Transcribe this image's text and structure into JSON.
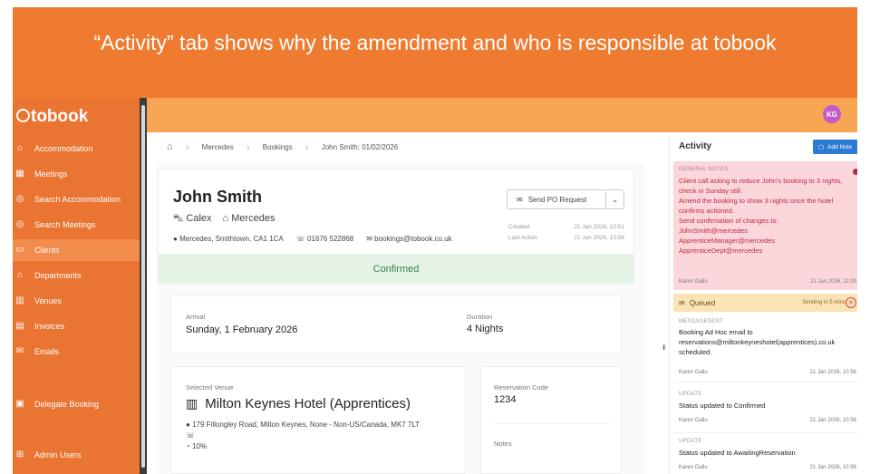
{
  "banner": {
    "text": "“Activity” tab shows why the amendment and who is responsible at tobook"
  },
  "sidebar": {
    "logo_o": "O",
    "logo_text": "tobook",
    "items": [
      {
        "label": "Accommodation",
        "icon": "house-icon"
      },
      {
        "label": "Meetings",
        "icon": "meetings-icon"
      },
      {
        "label": "Search Accommodation",
        "icon": "compass-icon"
      },
      {
        "label": "Search Meetings",
        "icon": "compass-icon"
      },
      {
        "label": "Clients",
        "icon": "clients-icon"
      },
      {
        "label": "Departments",
        "icon": "departments-icon"
      },
      {
        "label": "Venues",
        "icon": "building-icon"
      },
      {
        "label": "Invoices",
        "icon": "invoice-icon"
      },
      {
        "label": "Emails",
        "icon": "mail-icon"
      },
      {
        "label": "Delegate Booking",
        "icon": "calendar-icon"
      },
      {
        "label": "Admin Users",
        "icon": "admin-icon"
      }
    ],
    "active_item": "Clients"
  },
  "topbar": {
    "avatar_initials": "KG"
  },
  "breadcrumb": [
    "Mercedes",
    "Bookings",
    "John Smith: 01/02/2026"
  ],
  "booking": {
    "client_name": "John Smith",
    "tag_company": "Calex",
    "tag_client": "Mercedes",
    "address": "Mercedes, Smithtown, CA1 1CA",
    "phone": "01676 522868",
    "email": "bookings@tobook.co.uk",
    "po_button": "Send PO Request",
    "created_label": "Created",
    "created_value": "21 Jan 2026, 10:51",
    "last_action_label": "Last Action",
    "last_action_value": "21 Jan 2026, 10:56",
    "status": "Confirmed",
    "arrival_label": "Arrival",
    "arrival_value": "Sunday, 1 February 2026",
    "duration_label": "Duration",
    "duration_value": "4 Nights",
    "venue_label": "Selected Venue",
    "venue_name": "Milton Keynes Hotel (Apprentices)",
    "venue_address": "179 Fillongley Road, Milton Keynes, None - Non-US/Canada, MK7 7LT",
    "venue_percent": "10%",
    "res_code_label": "Reservation Code",
    "res_code_value": "1234",
    "notes_label": "Notes"
  },
  "activity": {
    "title": "Activity",
    "add_note": "Add Note",
    "general_note": {
      "tag": "GENERAL NOTES",
      "lines": [
        "Client call asking to reduce John's booking to 3 nights, check in Sunday still.",
        "Amend the booking to show 3 nights once the hotel confirms actioned.",
        "Send confirmation of changes to:",
        "JohnSmith@mercedes",
        "ApprenticeManager@mercedes",
        "ApprenticeDept@mercedes"
      ],
      "author": "Karen Gallo",
      "time": "21 Jan 2026, 11:00"
    },
    "queued": {
      "label": "Queued",
      "right": "Sending in 5 mins"
    },
    "entries": [
      {
        "tag": "MESSAGESENT",
        "text": "Booking Ad Hoc email to reservations@miltonkeyneshotel(apprentices).co.uk scheduled.",
        "author": "Karen Gallo",
        "time": "21 Jan 2026, 10:56"
      },
      {
        "tag": "UPDATE",
        "text": "Status updated to Confirmed",
        "author": "Karen Gallo",
        "time": "21 Jan 2026, 10:56"
      },
      {
        "tag": "UPDATE",
        "text": "Status updated to AwaitingReservation",
        "author": "Karen Gallo",
        "time": "21 Jan 2026, 10:56"
      }
    ]
  }
}
